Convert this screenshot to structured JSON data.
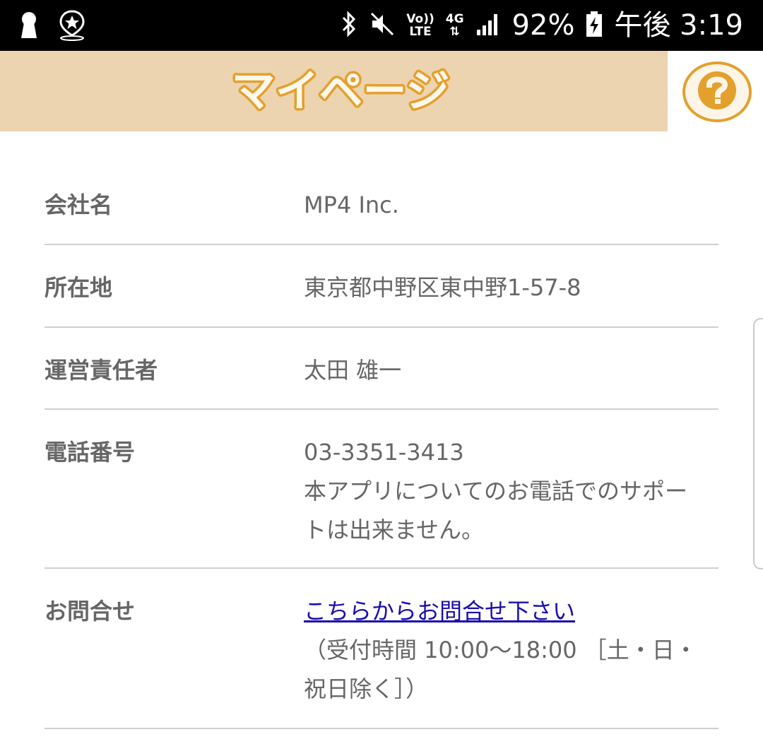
{
  "status_bar": {
    "signal_text_volte_top": "Vo))",
    "signal_text_volte_bottom": "LTE",
    "network": "4G",
    "battery": "92%",
    "time": "午後 3:19"
  },
  "header": {
    "title": "マイページ",
    "help_icon": "question-icon",
    "accent_color": "#e3a02d",
    "bar_color": "#edd4b0"
  },
  "info": {
    "rows": [
      {
        "label": "会社名",
        "lines": [
          "MP4 Inc."
        ]
      },
      {
        "label": "所在地",
        "lines": [
          "東京都中野区東中野1-57-8"
        ]
      },
      {
        "label": "運営責任者",
        "lines": [
          "太田 雄一"
        ]
      },
      {
        "label": "電話番号",
        "lines": [
          "03-3351-3413",
          "本アプリについてのお電話でのサポー",
          "トは出来ません。"
        ]
      },
      {
        "label": "お問合せ",
        "link": "こちらからお問合せ下さい",
        "lines": [
          "（受付時間 10:00〜18:00 ［土・日・",
          "祝日除く］）"
        ]
      }
    ]
  }
}
